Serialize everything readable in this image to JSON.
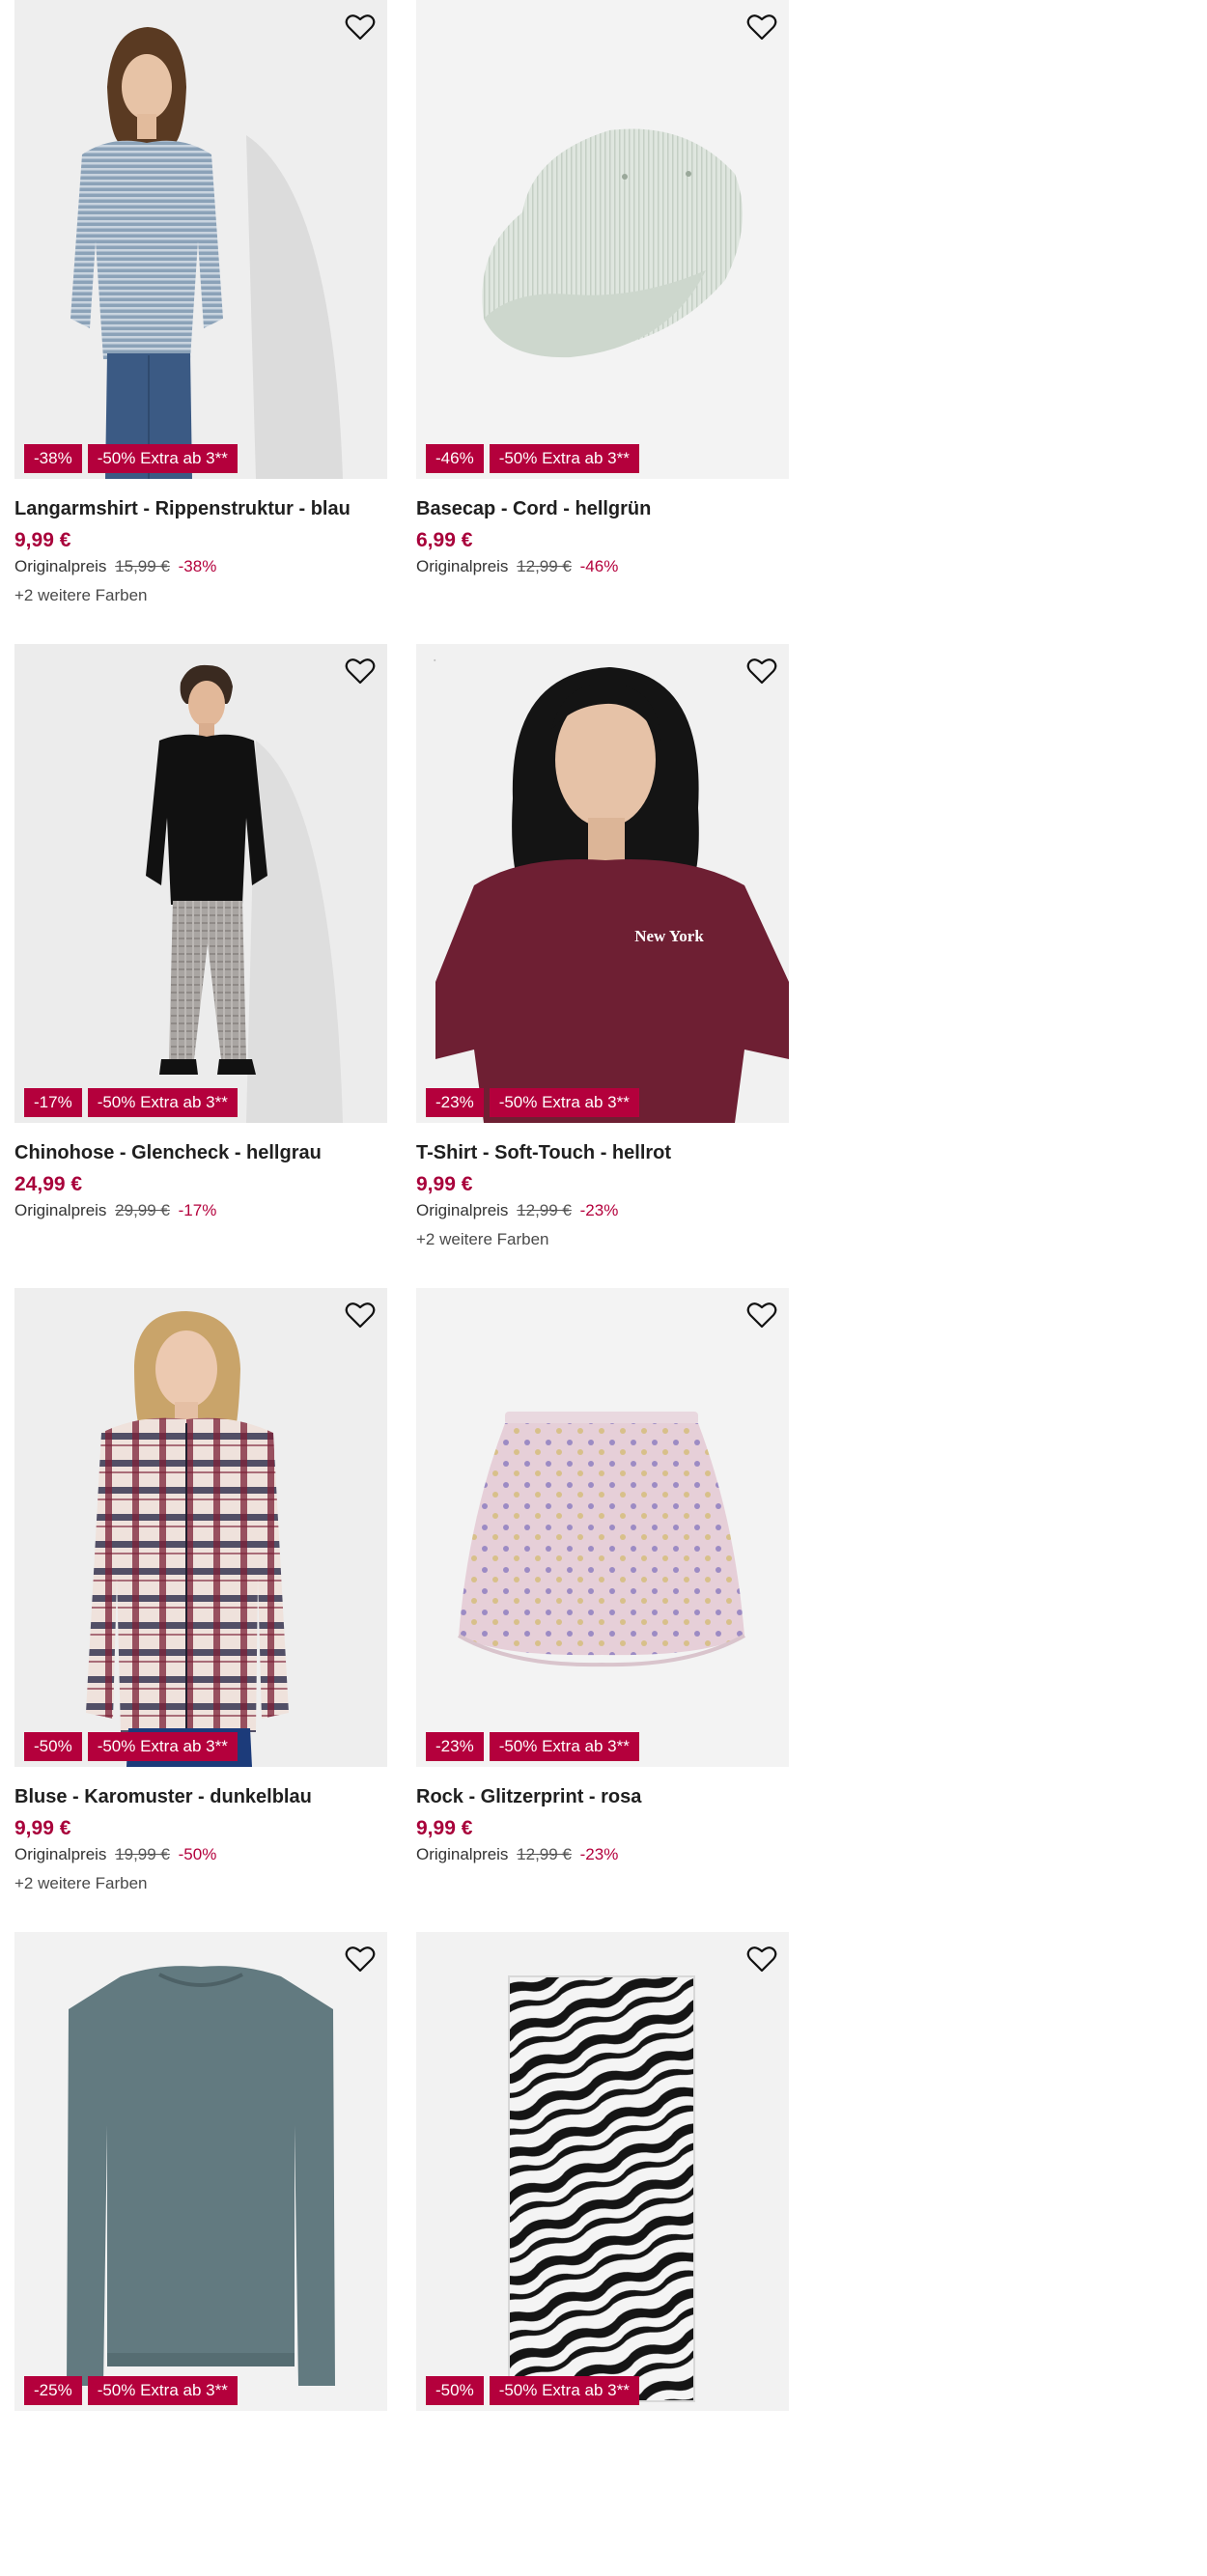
{
  "products": [
    {
      "title": "Langarmshirt - Rippenstruktur - blau",
      "price": "9,99 €",
      "orig_label": "Originalpreis",
      "orig_price": "15,99 €",
      "orig_discount": "-38%",
      "discount_badge": "-38%",
      "extra_badge": "-50% Extra ab 3**",
      "colors_text": "+2 weitere Farben",
      "image_icon": "model-striped-longsleeve-image"
    },
    {
      "title": "Basecap - Cord - hellgrün",
      "price": "6,99 €",
      "orig_label": "Originalpreis",
      "orig_price": "12,99 €",
      "orig_discount": "-46%",
      "discount_badge": "-46%",
      "extra_badge": "-50% Extra ab 3**",
      "colors_text": "",
      "image_icon": "corduroy-cap-image"
    },
    {
      "title": "Chinohose - Glencheck - hellgrau",
      "price": "24,99 €",
      "orig_label": "Originalpreis",
      "orig_price": "29,99 €",
      "orig_discount": "-17%",
      "discount_badge": "-17%",
      "extra_badge": "-50% Extra ab 3**",
      "colors_text": "",
      "image_icon": "model-check-chinos-image"
    },
    {
      "title": "T-Shirt - Soft-Touch - hellrot",
      "price": "9,99 €",
      "orig_label": "Originalpreis",
      "orig_price": "12,99 €",
      "orig_discount": "-23%",
      "discount_badge": "-23%",
      "extra_badge": "-50% Extra ab 3**",
      "colors_text": "+2 weitere Farben",
      "image_icon": "model-burgundy-tshirt-image",
      "print_text": "New York"
    },
    {
      "title": "Bluse - Karomuster - dunkelblau",
      "price": "9,99 €",
      "orig_label": "Originalpreis",
      "orig_price": "19,99 €",
      "orig_discount": "-50%",
      "discount_badge": "-50%",
      "extra_badge": "-50% Extra ab 3**",
      "colors_text": "+2 weitere Farben",
      "image_icon": "model-plaid-blouse-image"
    },
    {
      "title": "Rock - Glitzerprint - rosa",
      "price": "9,99 €",
      "orig_label": "Originalpreis",
      "orig_price": "12,99 €",
      "orig_discount": "-23%",
      "discount_badge": "-23%",
      "extra_badge": "-50% Extra ab 3**",
      "colors_text": "",
      "image_icon": "pink-glitter-skirt-image"
    },
    {
      "title": "",
      "price": "",
      "orig_label": "",
      "orig_price": "",
      "orig_discount": "",
      "discount_badge": "-25%",
      "extra_badge": "-50% Extra ab 3**",
      "colors_text": "",
      "image_icon": "sweatshirt-image"
    },
    {
      "title": "",
      "price": "",
      "orig_label": "",
      "orig_price": "",
      "orig_discount": "",
      "discount_badge": "-50%",
      "extra_badge": "-50% Extra ab 3**",
      "colors_text": "",
      "image_icon": "zebra-scarf-image"
    }
  ],
  "colors": {
    "badge": "#b4003c",
    "price": "#a8003a",
    "image_bg": "#f2f2f2"
  },
  "icons": {
    "wishlist": "heart-icon"
  }
}
